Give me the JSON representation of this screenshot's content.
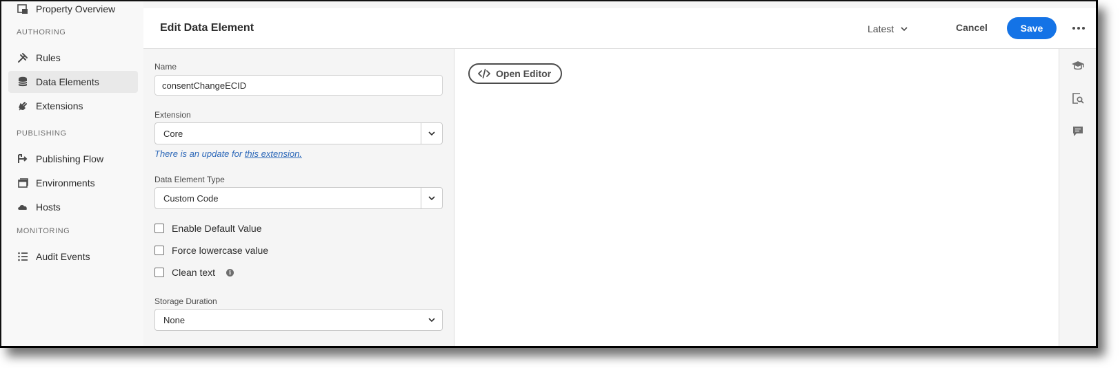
{
  "sidebar": {
    "top_item": {
      "label": "Property Overview",
      "icon": "property-overview-icon"
    },
    "sections": {
      "authoring": "AUTHORING",
      "publishing": "PUBLISHING",
      "monitoring": "MONITORING"
    },
    "items": [
      {
        "label": "Rules",
        "icon": "rules-icon"
      },
      {
        "label": "Data Elements",
        "icon": "database-icon",
        "selected": true
      },
      {
        "label": "Extensions",
        "icon": "plug-icon"
      },
      {
        "label": "Publishing Flow",
        "icon": "publishing-flow-icon"
      },
      {
        "label": "Environments",
        "icon": "environments-icon"
      },
      {
        "label": "Hosts",
        "icon": "cloud-icon"
      },
      {
        "label": "Audit Events",
        "icon": "list-icon"
      }
    ]
  },
  "header": {
    "title": "Edit Data Element",
    "version": "Latest",
    "cancel_label": "Cancel",
    "save_label": "Save"
  },
  "form": {
    "name_label": "Name",
    "name_value": "consentChangeECID",
    "extension_label": "Extension",
    "extension_value": "Core",
    "update_note": "There is an update for ",
    "update_link": "this extension.",
    "type_label": "Data Element Type",
    "type_value": "Custom Code",
    "checkboxes": {
      "default_value": "Enable Default Value",
      "lowercase": "Force lowercase value",
      "clean_text": "Clean text"
    },
    "storage_label": "Storage Duration",
    "storage_value": "None"
  },
  "editor": {
    "open_editor_label": "Open Editor"
  },
  "colors": {
    "accent": "#1473e6",
    "link": "#2b67b8",
    "sidebar_bg": "#f8f8f8",
    "selected_bg": "#e9e9e9"
  }
}
